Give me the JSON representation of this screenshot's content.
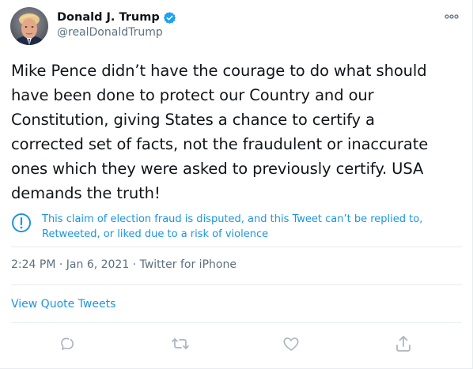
{
  "author": {
    "name": "Donald J. Trump",
    "handle": "@realDonaldTrump"
  },
  "tweet": {
    "text": "Mike Pence didn’t have the courage to do what should\nhave been done to protect our Country and our\nConstitution, giving States a chance to certify a\ncorrected set of facts, not the fraudulent or inaccurate\nones which they were asked to previously certify. USA\ndemands the truth!",
    "notice": "This claim of election fraud is disputed, and this Tweet can’t be replied to,\nRetweeted, or liked due to a risk of violence",
    "time": "2:24 PM",
    "separator": " · ",
    "date": "Jan 6, 2021",
    "source": "Twitter for iPhone"
  },
  "view_quote_tweets": "View Quote Tweets",
  "icons": {
    "verified": "verified-badge-icon",
    "more": "more-options-icon",
    "notice": "info-circle-icon",
    "actions": [
      "reply-icon",
      "retweet-icon",
      "like-icon",
      "share-icon"
    ]
  },
  "colors": {
    "text": "#0f1419",
    "secondary": "#5b7083",
    "accent": "#1b95e0",
    "divider": "#e6ecf0"
  }
}
